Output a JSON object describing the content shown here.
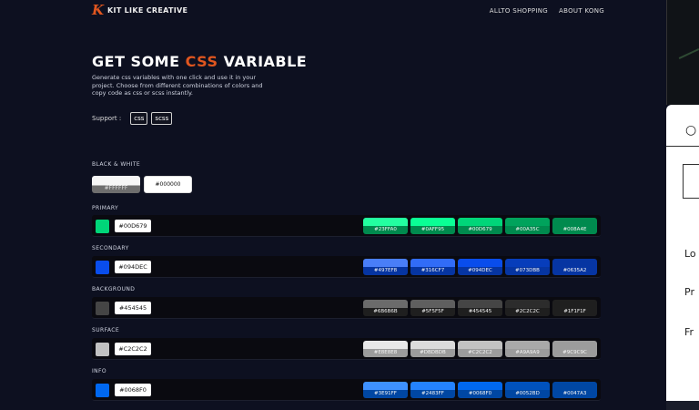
{
  "header": {
    "logo_mark": "K",
    "logo_text": "KIT LIKE CREATIVE",
    "nav": [
      "ALLTO SHOPPING",
      "ABOUT KONG"
    ]
  },
  "hero": {
    "title_pre": "GET SOME",
    "title_accent": "CSS",
    "title_post": "VARIABLE",
    "description": "Generate css variables with one click and use it in your project. Choose from different combinations of colors and copy code as css or scss instantly.",
    "support_label": "Support :",
    "tags": [
      "css",
      "scss"
    ]
  },
  "bw": {
    "label": "BLACK & WHITE",
    "white_hex": "#FFFFFF",
    "black_hex": "#000000"
  },
  "palettes": [
    {
      "label": "PRIMARY",
      "hex": "#00D679",
      "color": "#00d679",
      "shades": [
        {
          "hex": "#23FFA0",
          "color": "#23ffa0"
        },
        {
          "hex": "#0AFF95",
          "color": "#0aff95"
        },
        {
          "hex": "#00D679",
          "color": "#00d679"
        },
        {
          "hex": "#00A35C",
          "color": "#00a35c"
        },
        {
          "hex": "#008A4E",
          "color": "#008a4e"
        }
      ]
    },
    {
      "label": "SECONDARY",
      "hex": "#094DEC",
      "color": "#094dec",
      "shades": [
        {
          "hex": "#497EF8",
          "color": "#497ef8"
        },
        {
          "hex": "#316CF7",
          "color": "#316cf7"
        },
        {
          "hex": "#094DEC",
          "color": "#094dec"
        },
        {
          "hex": "#073DBB",
          "color": "#073dbb"
        },
        {
          "hex": "#0635A2",
          "color": "#0635a2"
        }
      ]
    },
    {
      "label": "BACKGROUND",
      "hex": "#454545",
      "color": "#454545",
      "shades": [
        {
          "hex": "#6B6B6B",
          "color": "#6b6b6b"
        },
        {
          "hex": "#5F5F5F",
          "color": "#5f5f5f"
        },
        {
          "hex": "#454545",
          "color": "#454545"
        },
        {
          "hex": "#2C2C2C",
          "color": "#2c2c2c"
        },
        {
          "hex": "#1F1F1F",
          "color": "#1f1f1f"
        }
      ]
    },
    {
      "label": "SURFACE",
      "hex": "#C2C2C2",
      "color": "#c2c2c2",
      "shades": [
        {
          "hex": "#E8E8E8",
          "color": "#e8e8e8"
        },
        {
          "hex": "#DBDBDB",
          "color": "#dbdbdb"
        },
        {
          "hex": "#C2C2C2",
          "color": "#c2c2c2"
        },
        {
          "hex": "#A9A9A9",
          "color": "#a9a9a9"
        },
        {
          "hex": "#9C9C9C",
          "color": "#9c9c9c"
        }
      ]
    },
    {
      "label": "INFO",
      "hex": "#0068F0",
      "color": "#0068f0",
      "shades": [
        {
          "hex": "#3E91FF",
          "color": "#3e91ff"
        },
        {
          "hex": "#2483FF",
          "color": "#2483ff"
        },
        {
          "hex": "#0068F0",
          "color": "#0068f0"
        },
        {
          "hex": "#0052BD",
          "color": "#0052bd"
        },
        {
          "hex": "#0047A3",
          "color": "#0047a3"
        }
      ]
    }
  ],
  "side_panel": {
    "items": [
      "Lo",
      "Pr",
      "Fr"
    ]
  }
}
